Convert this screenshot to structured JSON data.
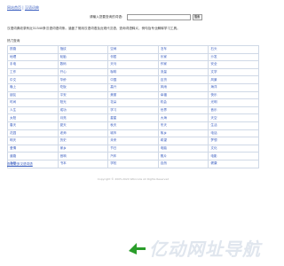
{
  "nav": {
    "home": "网站首页",
    "sep": "|",
    "dict": "汉语词典"
  },
  "search": {
    "label": "请输入您要查询的词语：",
    "placeholder": "",
    "button": "搜索"
  },
  "intro": "汉语词典收录有近31340条汉语词语词条。涵盖了常用汉语词语及近现代汉语，查询词语释义、例句及专业解释学习工具。",
  "hot_title": "热门查询",
  "words": [
    [
      "铁路",
      "指纹",
      "空间",
      "泊车",
      "石头"
    ],
    [
      "地理",
      "轮胎",
      "邻居",
      "乐家",
      "沙发"
    ],
    [
      "手电",
      "数码",
      "天马",
      "作家",
      "安全"
    ],
    [
      "工作",
      "开心",
      "咖啡",
      "流量",
      "文学"
    ],
    [
      "中文",
      "华侨",
      "中国",
      "百货",
      "风景"
    ],
    [
      "晚上",
      "吃饭",
      "高兴",
      "风雨",
      "海洋"
    ],
    [
      "朋友",
      "平安",
      "美丽",
      "幸福",
      "快乐"
    ],
    [
      "时间",
      "阳光",
      "花朵",
      "机会",
      "光明"
    ],
    [
      "人生",
      "成功",
      "学习",
      "世界",
      "音乐"
    ],
    [
      "太阳",
      "月亮",
      "星星",
      "大海",
      "天空"
    ],
    [
      "春天",
      "夏天",
      "秋天",
      "冬天",
      "生活"
    ],
    [
      "花园",
      "老师",
      "城市",
      "故乡",
      "电话"
    ],
    [
      "明天",
      "历史",
      "未来",
      "希望",
      "梦想"
    ],
    [
      "爱情",
      "家乡",
      "节日",
      "电脑",
      "文化"
    ],
    [
      "道路",
      "音响",
      "汽车",
      "照片",
      "电影"
    ],
    [
      "手机",
      "书本",
      "学校",
      "自然",
      "健康"
    ]
  ],
  "more_link": "查看更多汉语词语",
  "copyright": "Copyright © 2005-2024 Wikicode All Rights Reserved",
  "logo_text": "亿动网址导航",
  "colors": {
    "link": "#3b5fc0",
    "border": "#cfd8e6",
    "logo_green": "#2a9d2a"
  }
}
